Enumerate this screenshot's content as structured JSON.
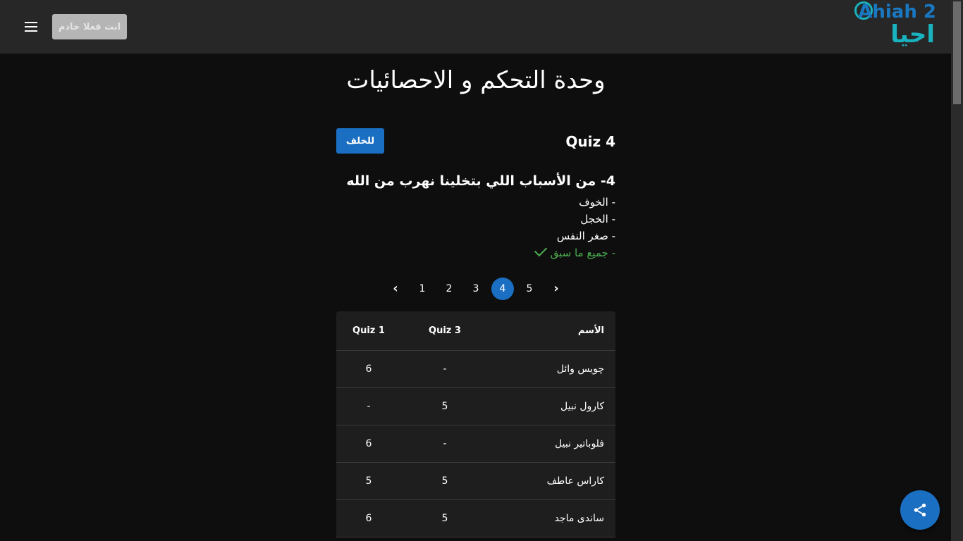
{
  "header": {
    "server_button_label": "انت فعلا خادم",
    "logo_latin": "Ahiah 2",
    "logo_arabic": "احيا"
  },
  "page": {
    "title": "وحدة التحكم و الاحصائيات",
    "quiz_title": "Quiz 4",
    "back_label": "للخلف"
  },
  "question": {
    "text": "4- من الأسباب اللي بتخلينا نهرب من الله",
    "options": [
      {
        "label": "- الخوف",
        "correct": false
      },
      {
        "label": "- الخجل",
        "correct": false
      },
      {
        "label": "- صغر النفس",
        "correct": false
      },
      {
        "label": "- جميع ما سبق",
        "correct": true
      }
    ]
  },
  "pagination": {
    "pages": [
      "1",
      "2",
      "3",
      "4",
      "5"
    ],
    "active": "4"
  },
  "table": {
    "headers": {
      "name": "الأسم",
      "q3": "Quiz 3",
      "q1": "Quiz 1"
    },
    "rows": [
      {
        "name": "چويس وائل",
        "q3": "-",
        "q1": "6"
      },
      {
        "name": "كارول نبيل",
        "q3": "5",
        "q1": "-"
      },
      {
        "name": "فلوباتير نبيل",
        "q3": "-",
        "q1": "6"
      },
      {
        "name": "كاراس عاطف",
        "q3": "5",
        "q1": "5"
      },
      {
        "name": "ساندى ماجد",
        "q3": "5",
        "q1": "6"
      }
    ]
  },
  "colors": {
    "accent": "#1a6fc2",
    "correct": "#4caf50",
    "topbar": "#272727",
    "background": "#0e0e0e"
  }
}
